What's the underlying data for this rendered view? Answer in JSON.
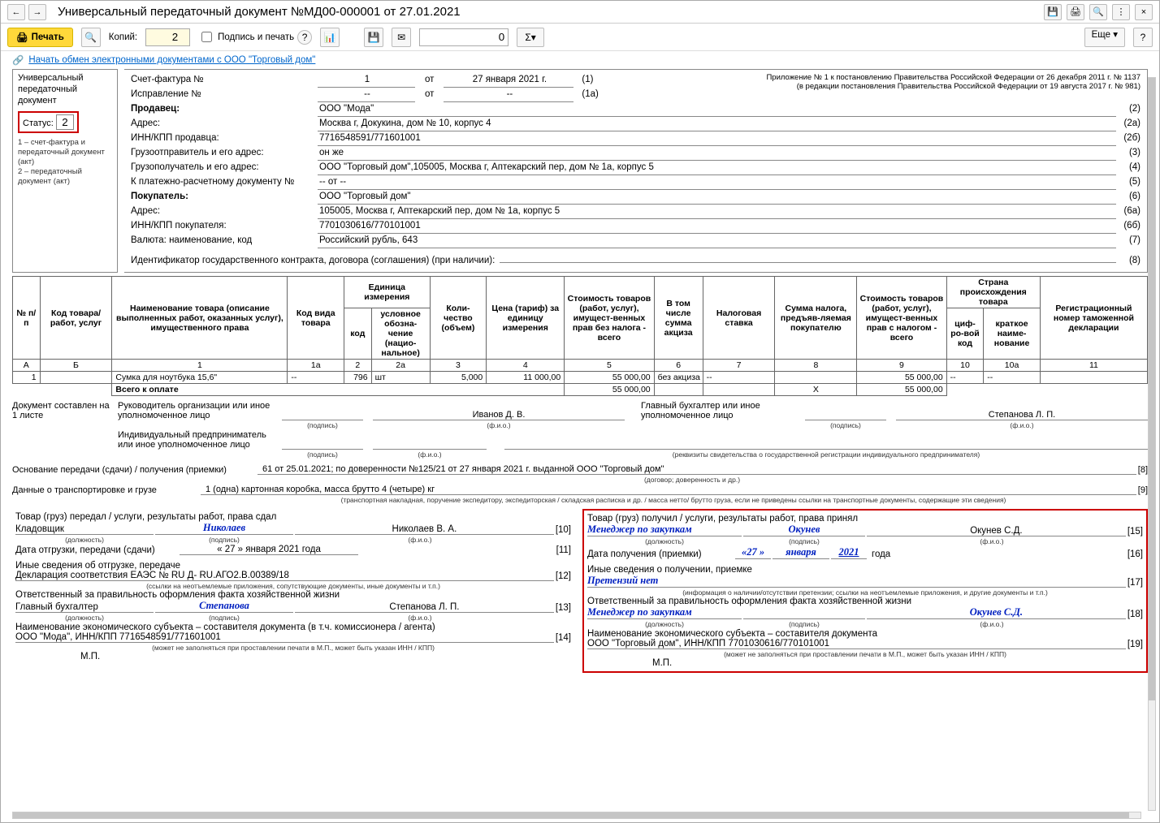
{
  "titlebar": {
    "title": "Универсальный передаточный документ №МД00-000001 от 27.01.2021",
    "back": "←",
    "fwd": "→"
  },
  "titleicons": {
    "save": "💾",
    "print": "🖨",
    "preview": "🔍",
    "menu": "⋮",
    "close": "×"
  },
  "toolbar": {
    "print": "Печать",
    "copies_label": "Копий:",
    "copies": "2",
    "sign_print": "Подпись и печать",
    "num_val": "0",
    "sum_tip": "Σ",
    "more": "Еще ▾",
    "help": "?"
  },
  "toolicons": {
    "preview": "🔍",
    "format": "📊",
    "save": "💾",
    "mail": "✉"
  },
  "info": {
    "icon": "🔗",
    "text": "Начать обмен электронными документами с ООО \"Торговый дом\""
  },
  "left": {
    "title1": "Универсальный",
    "title2": "передаточный",
    "title3": "документ",
    "status_lbl": "Статус:",
    "status": "2",
    "note": "1 – счет-фактура и передаточный документ (акт)\n2 – передаточный документ (акт)"
  },
  "appendix": {
    "l1": "Приложение № 1 к постановлению Правительства Российской Федерации от 26 декабря 2011 г. № 1137",
    "l2": "(в редакции постановления Правительства Российской Федерации от 19 августа 2017 г. № 981)"
  },
  "hdr": {
    "sf_lbl": "Счет-фактура №",
    "sf_num": "1",
    "sf_ot": "от",
    "sf_date": "27 января 2021 г.",
    "sf_n": "(1)",
    "isp_lbl": "Исправление №",
    "isp_num": "--",
    "isp_ot": "от",
    "isp_date": "--",
    "isp_n": "(1а)",
    "seller_lbl": "Продавец:",
    "seller": "ООО \"Мода\"",
    "seller_n": "(2)",
    "addr_lbl": "Адрес:",
    "addr": "Москва г, Докукина, дом № 10, корпус 4",
    "addr_n": "(2а)",
    "inn_lbl": "ИНН/КПП продавца:",
    "inn": "7716548591/771601001",
    "inn_n": "(2б)",
    "shipper_lbl": "Грузоотправитель и его адрес:",
    "shipper": "он же",
    "shipper_n": "(3)",
    "cons_lbl": "Грузополучатель и его адрес:",
    "cons": "ООО \"Торговый дом\",105005, Москва г, Аптекарский пер, дом № 1а, корпус 5",
    "cons_n": "(4)",
    "pay_lbl": "К платежно-расчетному документу №",
    "pay": "-- от --",
    "pay_n": "(5)",
    "buyer_lbl": "Покупатель:",
    "buyer": "ООО \"Торговый дом\"",
    "buyer_n": "(6)",
    "baddr_lbl": "Адрес:",
    "baddr": "105005, Москва г, Аптекарский пер, дом № 1а, корпус 5",
    "baddr_n": "(6а)",
    "binn_lbl": "ИНН/КПП покупателя:",
    "binn": "7701030616/770101001",
    "binn_n": "(6б)",
    "curr_lbl": "Валюта: наименование, код",
    "curr": "Российский рубль, 643",
    "curr_n": "(7)",
    "gos_lbl": "Идентификатор государственного контракта, договора (соглашения) (при наличии):",
    "gos": "",
    "gos_n": "(8)"
  },
  "tbl": {
    "h": {
      "npp": "№ п/п",
      "code": "Код товара/ работ, услуг",
      "name": "Наименование товара (описание выполненных работ, оказанных услуг), имущественного права",
      "kvt": "Код вида товара",
      "unit": "Единица измерения",
      "u_code": "код",
      "u_name": "условное обозна-чение (нацио-нальное)",
      "qty": "Коли-чество (объем)",
      "price": "Цена (тариф) за единицу измерения",
      "cost1": "Стоимость товаров (работ, услуг), имущест-венных прав без налога - всего",
      "excise": "В том числе сумма акциза",
      "rate": "Налоговая ставка",
      "tax": "Сумма налога, предъяв-ляемая покупателю",
      "cost2": "Стоимость товаров (работ, услуг), имущест-венных прав с налогом - всего",
      "country": "Страна происхождения товара",
      "c_code": "циф-ро-вой код",
      "c_name": "краткое наиме-нование",
      "reg": "Регистрационный номер таможенной декларации"
    },
    "cols": {
      "a": "А",
      "b": "Б",
      "c1": "1",
      "c1a": "1а",
      "c2": "2",
      "c2a": "2а",
      "c3": "3",
      "c4": "4",
      "c5": "5",
      "c6": "6",
      "c7": "7",
      "c8": "8",
      "c9": "9",
      "c10": "10",
      "c10a": "10а",
      "c11": "11"
    },
    "row": {
      "n": "1",
      "code": "",
      "name": "Сумка для ноутбука 15,6\"",
      "kvt": "--",
      "ucode": "796",
      "uname": "шт",
      "qty": "5,000",
      "price": "11 000,00",
      "cost1": "55 000,00",
      "excise": "без акциза",
      "rate": "--",
      "tax": "",
      "cost2": "55 000,00",
      "ccode": "--",
      "cname": "--",
      "reg": ""
    },
    "total_lbl": "Всего к оплате",
    "total_cost1": "55 000,00",
    "total_x": "X",
    "total_cost2": "55 000,00"
  },
  "sig": {
    "sheets": "Документ составлен на 1 листе",
    "ruk": "Руководитель организации или иное уполномоченное лицо",
    "ruk_fio": "Иванов Д. В.",
    "gb": "Главный бухгалтер или иное уполномоченное лицо",
    "gb_fio": "Степанова Л. П.",
    "ip": "Индивидуальный предприниматель или иное уполномоченное лицо",
    "podpis": "(подпись)",
    "fio": "(ф.и.о.)",
    "ip_note": "(реквизиты свидетельства о государственной регистрации индивидуального предпринимателя)",
    "osn_lbl": "Основание передачи (сдачи) / получения (приемки)",
    "osn": "61 от 25.01.2021; по доверенности №125/21 от 27 января 2021 г. выданной ООО \"Торговый дом\"",
    "osn_note": "(договор; доверенность и др.)",
    "osn_n": "[8]",
    "trans_lbl": "Данные о транспортировке и грузе",
    "trans": "1 (одна) картонная коробка, масса брутто 4 (четыре) кг",
    "trans_note": "(транспортная накладная, поручение экспедитору, экспедиторская / складская расписка и др. / масса нетто/ брутто груза, если не приведены ссылки на транспортные документы, содержащие эти сведения)",
    "trans_n": "[9]"
  },
  "left_bot": {
    "l1": "Товар (груз) передал / услуги, результаты работ, права сдал",
    "pos": "Кладовщик",
    "sig": "Николаев",
    "fio": "Николаев В. А.",
    "n": "[10]",
    "posL": "(должность)",
    "sigL": "(подпись)",
    "fioL": "(ф.и.о.)",
    "date_lbl": "Дата отгрузки, передачи (сдачи)",
    "date": "« 27 »   января   2021   года",
    "date_n": "[11]",
    "other_lbl": "Иные сведения об отгрузке, передаче",
    "other": "Декларация соответствия ЕАЭС № RU Д- RU.АГО2.В.00389/18",
    "other_n": "[12]",
    "other_note": "(ссылки на неотъемлемые приложения, сопутствующие документы, иные документы и т.п.)",
    "resp_lbl": "Ответственный за правильность оформления факта хозяйственной жизни",
    "resp_pos": "Главный бухгалтер",
    "resp_sig": "Степанова",
    "resp_fio": "Степанова Л. П.",
    "resp_n": "[13]",
    "econ_lbl": "Наименование экономического субъекта – составителя документа (в т.ч. комиссионера / агента)",
    "econ": "ООО \"Мода\", ИНН/КПП 7716548591/771601001",
    "econ_n": "[14]",
    "econ_note": "(может не заполняться при проставлении печати в М.П., может быть указан ИНН / КПП)",
    "mp": "М.П."
  },
  "right_bot": {
    "l1": "Товар (груз) получил / услуги, результаты работ, права принял",
    "pos": "Менеджер по закупкам",
    "sig": "Окунев",
    "fio": "Окунев С.Д.",
    "n": "[15]",
    "posL": "(должность)",
    "sigL": "(подпись)",
    "fioL": "(ф.и.о.)",
    "date_lbl": "Дата получения (приемки)",
    "date_d": "«27 »",
    "date_m": "января",
    "date_y": "2021",
    "date_g": "года",
    "date_n": "[16]",
    "other_lbl": "Иные сведения о получении, приемке",
    "other": "Претензий нет",
    "other_n": "[17]",
    "other_note": "(информация о наличии/отсутствии претензии; ссылки на неотъемлемые приложения, и другие документы и т.п.)",
    "resp_lbl": "Ответственный за правильность оформления факта хозяйственной жизни",
    "resp_pos": "Менеджер по закупкам",
    "resp_sig": "",
    "resp_fio": "Окунев С.Д.",
    "resp_n": "[18]",
    "econ_lbl": "Наименование экономического субъекта – составителя документа",
    "econ": "ООО \"Торговый дом\", ИНН/КПП 7701030616/770101001",
    "econ_n": "[19]",
    "econ_note": "(может не заполняться при проставлении печати в М.П., может быть указан ИНН / КПП)",
    "mp": "М.П."
  }
}
